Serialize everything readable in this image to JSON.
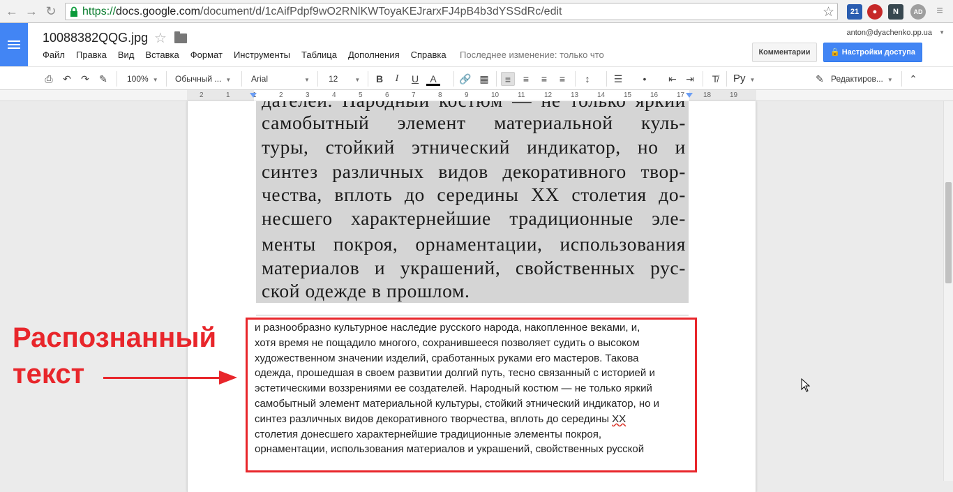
{
  "browser": {
    "url_proto": "https://",
    "url_host": "docs.google.com",
    "url_path": "/document/d/1cAifPdpf9wO2RNlKWToyaKEJrarxFJ4pB4b3dYSSdRc/edit",
    "ext_badge_1": "21",
    "ext_badge_2": "N",
    "ext_badge_3": "AD"
  },
  "docs": {
    "title": "10088382QQG.jpg",
    "menu": [
      "Файл",
      "Правка",
      "Вид",
      "Вставка",
      "Формат",
      "Инструменты",
      "Таблица",
      "Дополнения",
      "Справка"
    ],
    "last_edit": "Последнее изменение: только что",
    "account": "anton@dyachenko.pp.ua",
    "comments_label": "Комментарии",
    "share_label": "Настройки доступа"
  },
  "toolbar": {
    "zoom": "100%",
    "style": "Обычный ...",
    "font": "Arial",
    "size": "12",
    "input_lang": "Ру",
    "mode": "Редактиров..."
  },
  "ruler": {
    "numbers": [
      "2",
      "1",
      "1",
      "2",
      "3",
      "4",
      "5",
      "6",
      "7",
      "8",
      "9",
      "10",
      "11",
      "12",
      "13",
      "14",
      "15",
      "16",
      "17",
      "18",
      "19"
    ]
  },
  "scan": {
    "lines": [
      "дателей. Народный костюм — не только яркий",
      "самобытный элемент материальной куль-",
      "туры, стойкий этнический индикатор, но и",
      "синтез различных видов декоративного твор-",
      "чества, вплоть до середины XX столетия до-",
      "несшего характернейшие традиционные эле-",
      "менты покроя, орнаментации, использования",
      "материалов и украшений, свойственных рус-",
      "ской одежде в прошлом."
    ]
  },
  "ocr": {
    "lines": [
      "и разнообразно культурное наследие русского народа, накопленное веками, и,",
      "хотя время не пощадило многого, сохранившееся позволяет судить о высоком",
      "художественном значении изделий, сработанных руками его мастеров. Такова",
      "одежда, прошедшая в своем развитии долгий путь, тесно связанный с историей и",
      "эстетическими воззрениями ее создателей. Народный костюм — не только яркий",
      "самобытный элемент материальной культуры, стойкий этнический индикатор, но и",
      "синтез различных видов декоративного творчества, вплоть до середины ",
      "столетия донесшего характернейшие традиционные элементы покроя,",
      "орнаментации, использования материалов и украшений, свойственных русской"
    ],
    "misspelled": "XX"
  },
  "annotation": {
    "label_line1": "Распознанный",
    "label_line2": "текст",
    "color": "#e8262b"
  },
  "colors": {
    "docs_blue": "#4285f4",
    "annotation_red": "#e8262b"
  }
}
